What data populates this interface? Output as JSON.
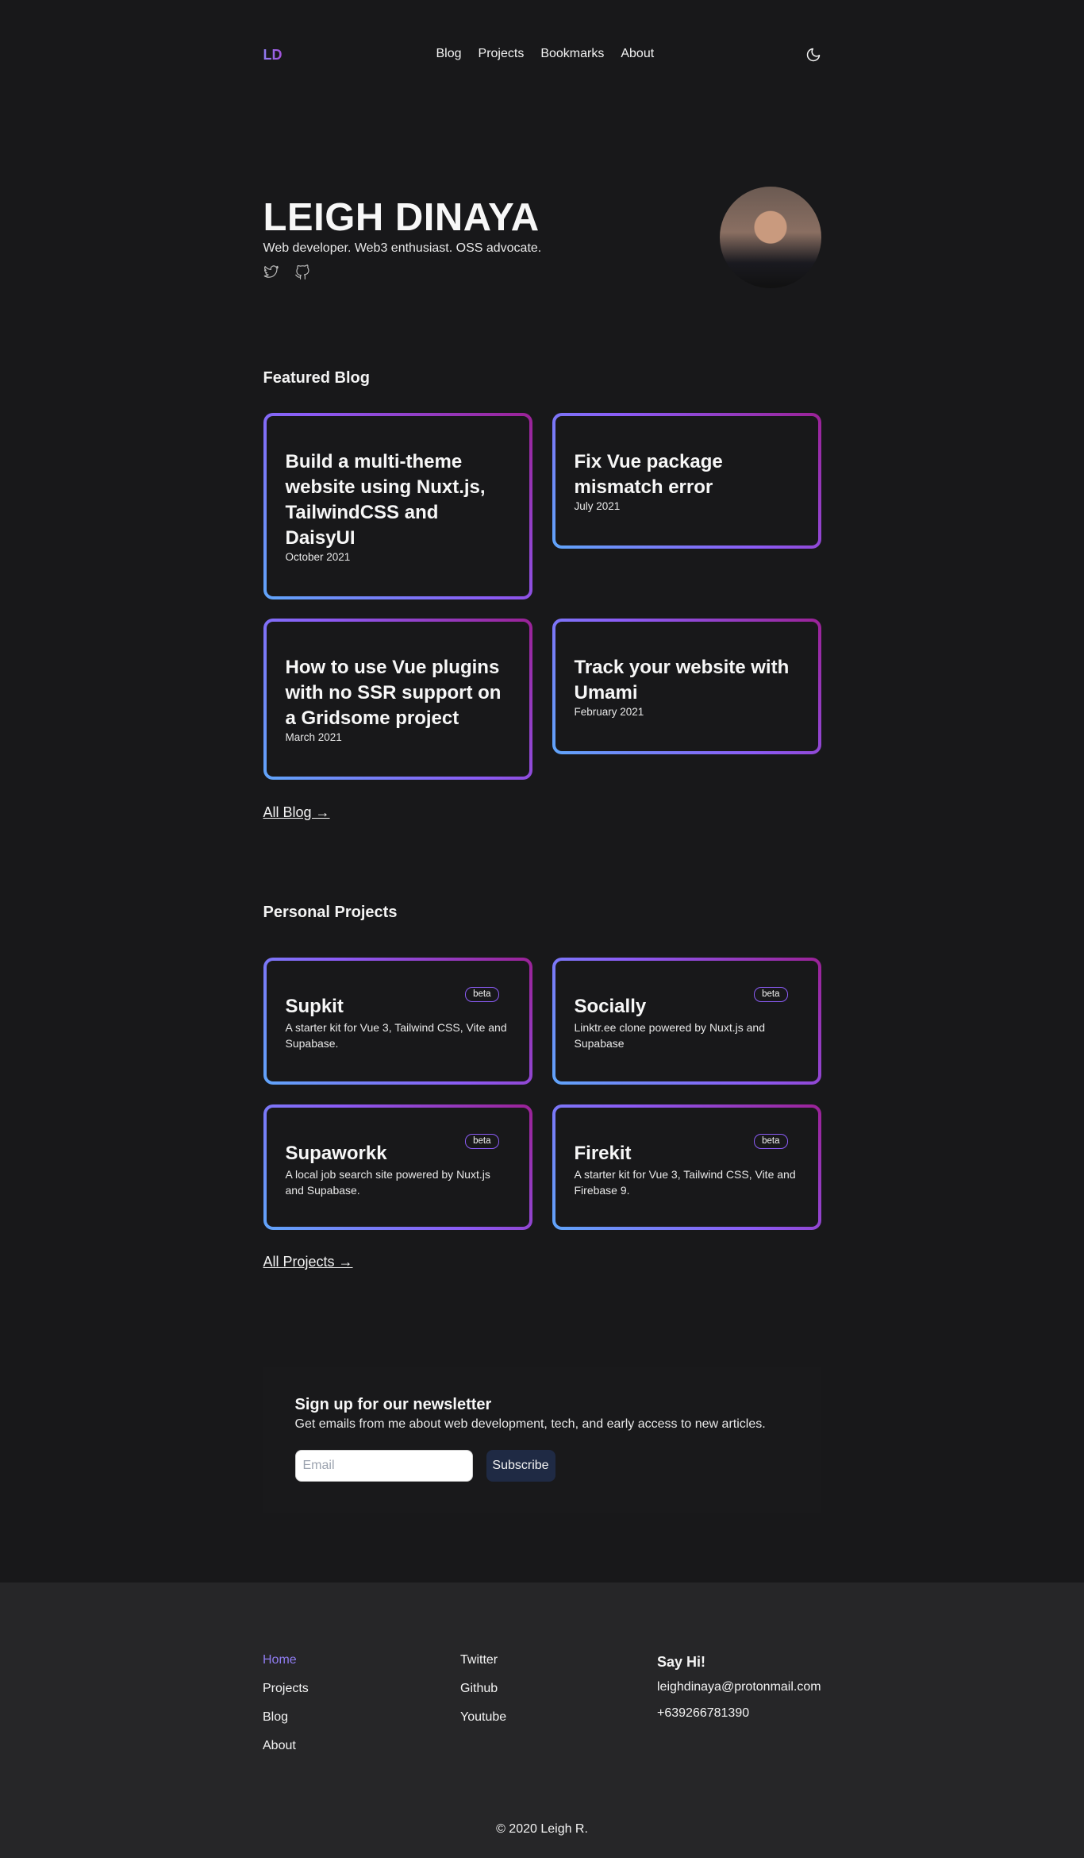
{
  "nav": {
    "logo": "LD",
    "links": [
      "Blog",
      "Projects",
      "Bookmarks",
      "About"
    ]
  },
  "hero": {
    "name": "LEIGH DINAYA",
    "tagline": "Web developer. Web3 enthusiast. OSS advocate."
  },
  "featured_blog": {
    "heading": "Featured Blog",
    "posts": [
      {
        "title": "Build a multi-theme website using Nuxt.js, TailwindCSS and DaisyUI",
        "date": "October 2021"
      },
      {
        "title": "Fix Vue package mismatch error",
        "date": "July 2021"
      },
      {
        "title": "How to use Vue plugins with no SSR support on a Gridsome project",
        "date": "March 2021"
      },
      {
        "title": "Track your website with Umami",
        "date": "February 2021"
      }
    ],
    "all_link": "All Blog →"
  },
  "projects": {
    "heading": "Personal Projects",
    "items": [
      {
        "title": "Supkit",
        "badge": "beta",
        "desc": "A starter kit for Vue 3, Tailwind CSS, Vite and Supabase."
      },
      {
        "title": "Socially",
        "badge": "beta",
        "desc": "Linktr.ee clone powered by Nuxt.js and Supabase"
      },
      {
        "title": "Supaworkk",
        "badge": "beta",
        "desc": "A local job search site powered by Nuxt.js and Supabase."
      },
      {
        "title": "Firekit",
        "badge": "beta",
        "desc": "A starter kit for Vue 3, Tailwind CSS, Vite and Firebase 9."
      }
    ],
    "all_link": "All Projects →"
  },
  "newsletter": {
    "title": "Sign up for our newsletter",
    "subtitle": "Get emails from me about web development, tech, and early access to new articles.",
    "placeholder": "Email",
    "button": "Subscribe"
  },
  "footer": {
    "nav": [
      "Home",
      "Projects",
      "Blog",
      "About"
    ],
    "social": [
      "Twitter",
      "Github",
      "Youtube"
    ],
    "contact_heading": "Say Hi!",
    "email": "leighdinaya@protonmail.com",
    "phone": "+639266781390",
    "copyright": "© 2020 Leigh R."
  },
  "colors": {
    "background": "#18181a",
    "footer_bg": "#262628",
    "accent": "#8f7cf0",
    "gradient": [
      "#60a5fa",
      "#8b5cf6",
      "#9b2196"
    ]
  },
  "icons": [
    "moon-icon",
    "twitter-icon",
    "github-icon"
  ]
}
